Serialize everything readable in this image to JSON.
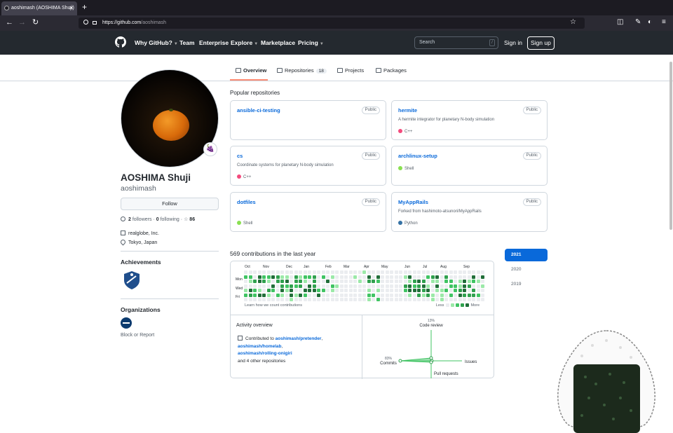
{
  "browser": {
    "tab_title": "aoshimash (AOSHIMA Shuji)",
    "tab_close": "✕",
    "new_tab": "+",
    "url_host": "https://github.com",
    "url_path": "/aoshimash"
  },
  "header": {
    "nav": [
      "Why GitHub?",
      "Team",
      "Enterprise",
      "Explore",
      "Marketplace",
      "Pricing"
    ],
    "search_placeholder": "Search",
    "search_key": "/",
    "sign_in": "Sign in",
    "sign_up": "Sign up"
  },
  "tabs": {
    "overview": "Overview",
    "repositories": "Repositories",
    "repositories_count": "18",
    "projects": "Projects",
    "packages": "Packages"
  },
  "profile": {
    "name": "AOSHIMA Shuji",
    "login": "aoshimash",
    "follow": "Follow",
    "followers_count": "2",
    "followers_label": "followers",
    "following_count": "0",
    "following_label": "following",
    "stars": "86",
    "company": "realglobe, Inc.",
    "location": "Tokyo, Japan",
    "achievements_title": "Achievements",
    "organizations_title": "Organizations",
    "block_report": "Block or Report",
    "status_emoji": "🍇"
  },
  "popular": {
    "title": "Popular repositories",
    "public_label": "Public",
    "repos": [
      {
        "name": "ansible-ci-testing",
        "desc": "",
        "lang": "",
        "lang_color": ""
      },
      {
        "name": "hermite",
        "desc": "A hermite integrator for planetary N-body simulation",
        "lang": "C++",
        "lang_color": "#f34b7d"
      },
      {
        "name": "cs",
        "desc": "Coordinate systems for planetary N-body simulation",
        "lang": "C++",
        "lang_color": "#f34b7d"
      },
      {
        "name": "archlinux-setup",
        "desc": "",
        "lang": "Shell",
        "lang_color": "#89e051"
      },
      {
        "name": "dotfiles",
        "desc": "",
        "lang": "Shell",
        "lang_color": "#89e051"
      },
      {
        "name": "MyAppRails",
        "desc": "Forked from hashimoto-atsunori/MyAppRails",
        "lang": "Python",
        "lang_color": "#3572A5"
      }
    ]
  },
  "contributions": {
    "title": "569 contributions in the last year",
    "months": [
      "Oct",
      "Nov",
      "Dec",
      "Jan",
      "Feb",
      "Mar",
      "Apr",
      "May",
      "Jun",
      "Jul",
      "Aug",
      "Sep"
    ],
    "days": [
      "Mon",
      "Wed",
      "Fri"
    ],
    "learn": "Learn how we count contributions",
    "less": "Less",
    "more": "More",
    "colors": [
      "#ebedf0",
      "#9be9a8",
      "#40c463",
      "#30a14e",
      "#216e39"
    ]
  },
  "activity": {
    "title": "Activity overview",
    "contributed_to": "Contributed to",
    "repos": [
      "aoshimash/pretender",
      "aoshimash/homelab",
      "aoshimash/rolling-onigiri"
    ],
    "others": "and 4 other repositories",
    "code_review_pct": "13%",
    "code_review": "Code review",
    "commits_pct": "83%",
    "commits": "Commits",
    "issues": "Issues",
    "pull_requests": "Pull requests"
  },
  "years": [
    "2021",
    "2020",
    "2019"
  ]
}
